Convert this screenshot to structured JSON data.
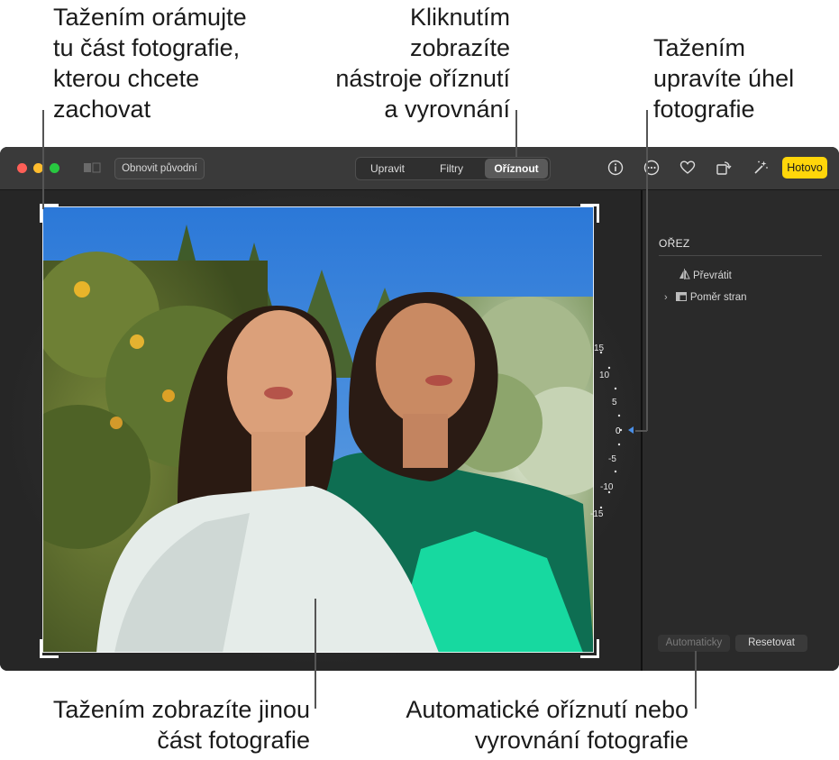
{
  "callouts": {
    "crop_frame": [
      "Tažením orámujte",
      "tu část fotografie,",
      "kterou chcete",
      "zachovat"
    ],
    "crop_tools": [
      "Kliknutím",
      "zobrazíte",
      "nástroje oříznutí",
      "a vyrovnání"
    ],
    "angle": [
      "Tažením",
      "upravíte úhel",
      "fotografie"
    ],
    "drag_photo": [
      "Tažením zobrazíte jinou",
      "část fotografie"
    ],
    "auto_crop": [
      "Automatické oříznutí nebo",
      "vyrovnání fotografie"
    ]
  },
  "toolbar": {
    "revert_label": "Obnovit původní",
    "tabs": [
      "Upravit",
      "Filtry",
      "Oříznout"
    ],
    "selected_tab": "Oříznout",
    "icons": [
      "info-icon",
      "more-icon",
      "heart-icon",
      "rotate-icon",
      "magic-wand-icon"
    ],
    "done_label": "Hotovo"
  },
  "dial": {
    "labels": [
      "15",
      "10",
      "5",
      "0",
      "-5",
      "-10",
      "-15"
    ],
    "current_value": "0"
  },
  "sidebar": {
    "title": "OŘEZ",
    "flip_label": "Převrátit",
    "aspect_label": "Poměr stran",
    "auto_label": "Automaticky",
    "reset_label": "Resetovat"
  },
  "colors": {
    "done_button": "#ffd60a",
    "close": "#fe5f57",
    "minimize": "#febc2e",
    "zoom": "#28c840",
    "dial_indicator": "#4a8fe7"
  }
}
